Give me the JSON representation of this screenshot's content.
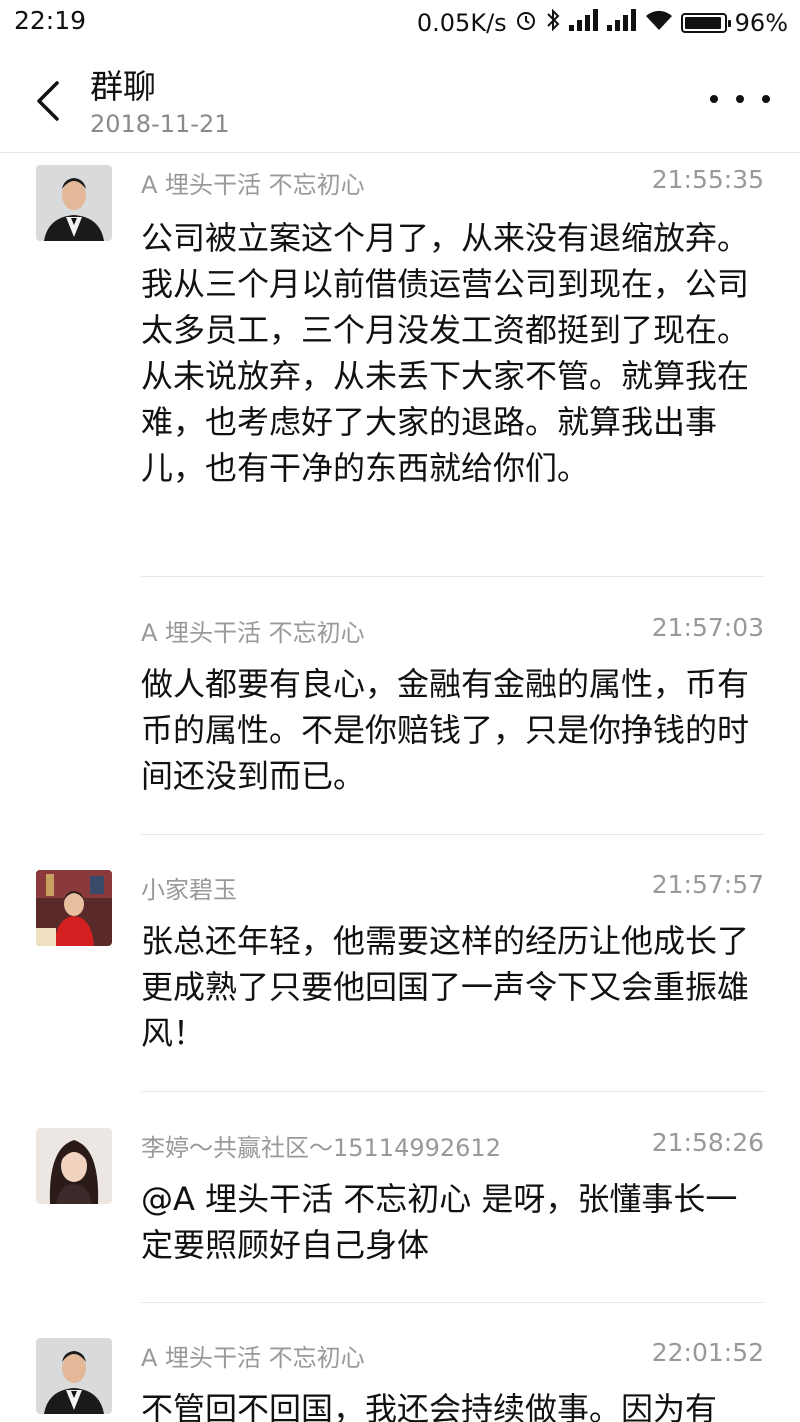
{
  "status_bar": {
    "time": "22:19",
    "network_speed": "0.05K/s",
    "battery_percent": "96%",
    "icons": [
      "alarm-icon",
      "bluetooth-icon",
      "signal-icon",
      "signal-icon",
      "wifi-icon",
      "battery-icon"
    ]
  },
  "header": {
    "title": "群聊",
    "date": "2018-11-21"
  },
  "messages": [
    {
      "sender": "A 埋头干活 不忘初心",
      "time": "21:55:35",
      "avatar": "avatar-man-suit",
      "text": "公司被立案这个月了，从来没有退缩放弃。我从三个月以前借债运营公司到现在，公司太多员工，三个月没发工资都挺到了现在。从未说放弃，从未丢下大家不管。就算我在难，也考虑好了大家的退路。就算我出事儿，也有干净的东西就给你们。"
    },
    {
      "sender": "A 埋头干活 不忘初心",
      "time": "21:57:03",
      "avatar": "",
      "text": "做人都要有良心，金融有金融的属性，币有币的属性。不是你赔钱了，只是你挣钱的时间还没到而已。"
    },
    {
      "sender": "小家碧玉",
      "time": "21:57:57",
      "avatar": "avatar-child-red",
      "text": "张总还年轻，他需要这样的经历让他成长了更成熟了只要他回国了一声令下又会重振雄风！"
    },
    {
      "sender": "李婷～共赢社区～15114992612",
      "time": "21:58:26",
      "avatar": "avatar-woman",
      "text": "@A 埋头干活 不忘初心 是呀，张懂事长一定要照顾好自己身体"
    },
    {
      "sender": "A 埋头干活 不忘初心",
      "time": "22:01:52",
      "avatar": "avatar-man-suit",
      "text": "不管回不回国，我还会持续做事。因为有"
    }
  ],
  "colors": {
    "meta_gray": "#999999",
    "divider": "#e6e6e6",
    "text": "#111111"
  }
}
